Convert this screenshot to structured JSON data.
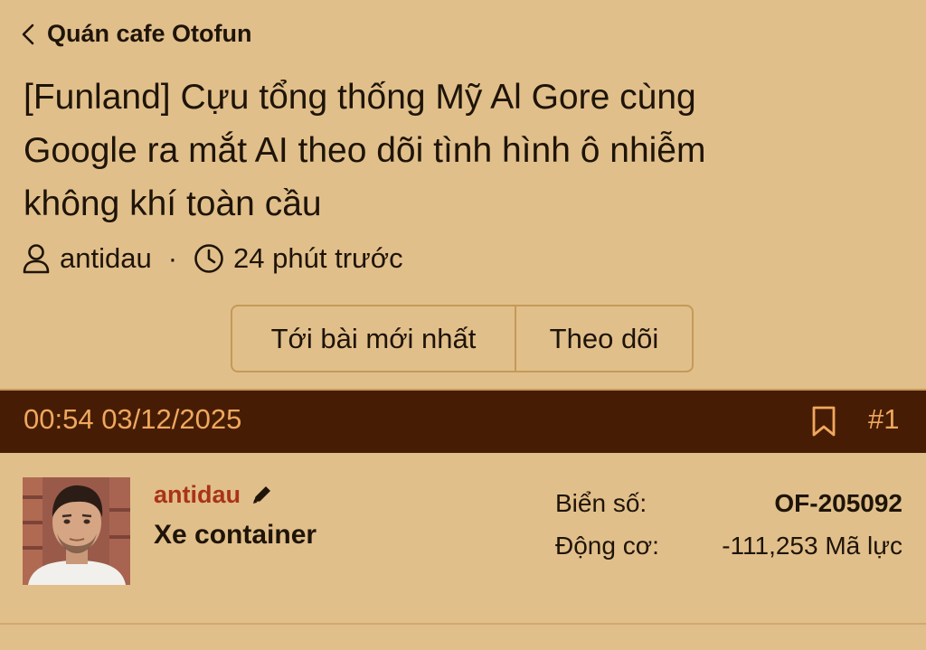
{
  "header": {
    "back_label": "Quán cafe Otofun"
  },
  "thread": {
    "title_line1": "[Funland] Cựu tổng thống Mỹ Al Gore cùng",
    "title_line2": "Google ra mắt AI theo dõi tình hình ô nhiễm",
    "title_line3": "không khí toàn cầu",
    "author": "antidau",
    "separator": "·",
    "time_ago": "24 phút trước",
    "buttons": {
      "latest": "Tới bài mới nhất",
      "follow": "Theo dõi"
    }
  },
  "post": {
    "datetime": "00:54 03/12/2025",
    "number": "#1",
    "username": "antidau",
    "user_title": "Xe container",
    "stats": {
      "plate_label": "Biển số:",
      "plate_value": "OF-205092",
      "engine_label": "Động cơ:",
      "engine_value": "-111,253 Mã lực"
    }
  },
  "colors": {
    "background": "#e1bf8b",
    "post_bar": "#461d04",
    "post_bar_text": "#f0a75e",
    "username": "#a83418",
    "button_border": "#c49a57"
  },
  "icons": {
    "back": "chevron-left-icon",
    "author": "user-icon",
    "time": "clock-icon",
    "bookmark": "bookmark-icon",
    "edit": "pencil-icon"
  }
}
